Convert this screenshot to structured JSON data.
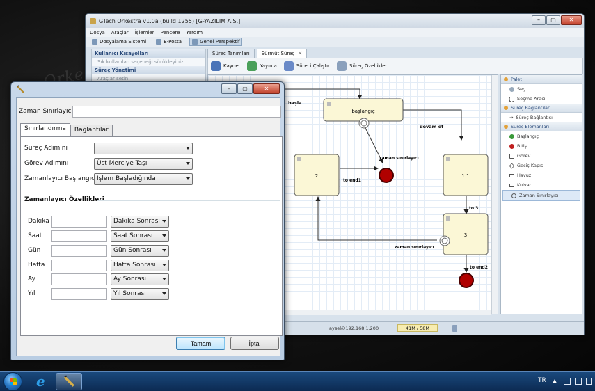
{
  "app": {
    "title": "GTech Orkestra v1.0a (build 1255) [G-YAZILIM A.Ş.]",
    "menu": [
      "Dosya",
      "Araçlar",
      "İşlemler",
      "Pencere",
      "Yardım"
    ],
    "toolbar": [
      "Dosyalama Sistemi",
      "E-Posta",
      "Genel Perspektif"
    ],
    "left_panel": {
      "header1": "Kullanıcı Kısayolları",
      "row1": "Sık kullanılan seçeneği sürükleyiniz",
      "header2": "Süreç Yönetimi",
      "row2": "Araçlar setin"
    },
    "editor_tabs": [
      "Süreç Tanımları",
      "Sürmüt Süreç"
    ],
    "editor_toolbar": [
      "Kaydet",
      "Yayınla",
      "Süreci Çalıştır",
      "Süreç Özellikleri"
    ],
    "diagram": {
      "nodes": {
        "start_name": "başlangıç",
        "node_2": "2",
        "node_11": "1.1",
        "node_3": "3"
      },
      "edges": {
        "basla": "başla",
        "devam_et": "devam et",
        "zaman_1": "zaman sınırlayıcı",
        "to_end1": "to end1",
        "to_3": "to 3",
        "zaman_2": "zaman sınırlayıcı",
        "to_end2": "to end2"
      }
    },
    "palette": {
      "header": "Palet",
      "tools": [
        "Seç",
        "Seçme Aracı"
      ],
      "connections_header": "Süreç Bağlantıları",
      "connections": [
        "Süreç Bağlantısı"
      ],
      "elements_header": "Süreç Elemanları",
      "elements": [
        "Başlangıç",
        "Bitiş",
        "Görev",
        "Geçiş Kapısı",
        "Havuz",
        "Kulvar",
        "Zaman Sınırlayıcı"
      ]
    },
    "status": {
      "user": "aysel@192.168.1.200",
      "memory": "41M / 58M"
    }
  },
  "dialog": {
    "name_label": "Zaman Sınırlayıcı",
    "name_value": "",
    "tabs": [
      "Sınırlandırma",
      "Bağlantılar"
    ],
    "fields": {
      "step_label": "Süreç Adımını",
      "step_value": "",
      "task_label": "Görev Adımını",
      "task_value": "Üst Merciye Taşı",
      "starter_label": "Zamanlayıcı Başlangıcı",
      "starter_value": "İşlem Başladığında"
    },
    "section_title": "Zamanlayıcı Özellikleri",
    "units": [
      {
        "label": "Dakika",
        "value": "",
        "option": "Dakika Sonrası"
      },
      {
        "label": "Saat",
        "value": "",
        "option": "Saat Sonrası"
      },
      {
        "label": "Gün",
        "value": "",
        "option": "Gün Sonrası"
      },
      {
        "label": "Hafta",
        "value": "",
        "option": "Hafta Sonrası"
      },
      {
        "label": "Ay",
        "value": "",
        "option": "Ay Sonrası"
      },
      {
        "label": "Yıl",
        "value": "",
        "option": "Yıl Sonrası"
      }
    ],
    "ok_label": "Tamam",
    "cancel_label": "İptal"
  },
  "taskbar": {
    "language": "TR"
  },
  "colors": {
    "node_fill": "#fbf7d6",
    "end_event": "#b00000",
    "taskbar": "#1a4a7e"
  }
}
